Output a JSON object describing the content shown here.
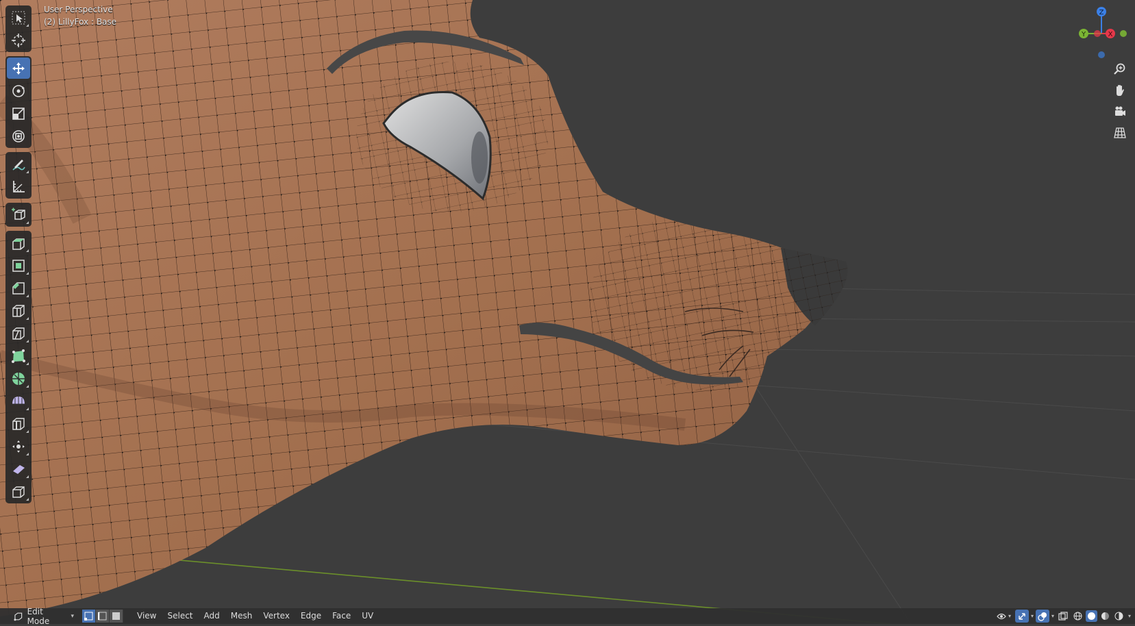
{
  "viewport": {
    "view_name": "User Perspective",
    "object_info": "(2) LillyFox : Base"
  },
  "colors": {
    "accent": "#4772b3",
    "background": "#3d3d3d",
    "mesh": "#a87356",
    "axis_x": "#e5384a",
    "axis_y": "#7bb534",
    "axis_z": "#3b80e6"
  },
  "toolbar": {
    "tools": [
      {
        "icon": "select-box-icon",
        "active": false
      },
      {
        "icon": "cursor-icon",
        "active": false
      },
      {
        "icon": "move-icon",
        "active": true
      },
      {
        "icon": "rotate-icon",
        "active": false
      },
      {
        "icon": "scale-icon",
        "active": false
      },
      {
        "icon": "transform-icon",
        "active": false
      },
      {
        "icon": "annotate-icon",
        "active": false
      },
      {
        "icon": "measure-icon",
        "active": false
      },
      {
        "icon": "add-cube-icon",
        "active": false
      },
      {
        "icon": "extrude-region-icon",
        "active": false
      },
      {
        "icon": "inset-faces-icon",
        "active": false
      },
      {
        "icon": "bevel-icon",
        "active": false
      },
      {
        "icon": "loop-cut-icon",
        "active": false
      },
      {
        "icon": "knife-icon",
        "active": false
      },
      {
        "icon": "poly-build-icon",
        "active": false
      },
      {
        "icon": "spin-icon",
        "active": false
      },
      {
        "icon": "smooth-icon",
        "active": false
      },
      {
        "icon": "edge-slide-icon",
        "active": false
      },
      {
        "icon": "shrink-fatten-icon",
        "active": false
      },
      {
        "icon": "shear-icon",
        "active": false
      },
      {
        "icon": "rip-region-icon",
        "active": false
      }
    ]
  },
  "gizmo": {
    "x_label": "X",
    "y_label": "Y",
    "z_label": "Z"
  },
  "nav_buttons": [
    "zoom-icon",
    "pan-hand-icon",
    "camera-view-icon",
    "ortho-grid-icon"
  ],
  "header": {
    "mode": "Edit Mode",
    "select_modes": [
      "vertex-select-icon",
      "edge-select-icon",
      "face-select-icon"
    ],
    "active_select_mode": "vertex-select-icon",
    "menus": [
      "View",
      "Select",
      "Add",
      "Mesh",
      "Vertex",
      "Edge",
      "Face",
      "UV"
    ],
    "right_icons": [
      "visibility-icon",
      "gizmo-icon",
      "overlay-icon",
      "xray-icon",
      "wireframe-shading-icon",
      "solid-shading-icon",
      "material-shading-icon",
      "rendered-shading-icon"
    ]
  }
}
